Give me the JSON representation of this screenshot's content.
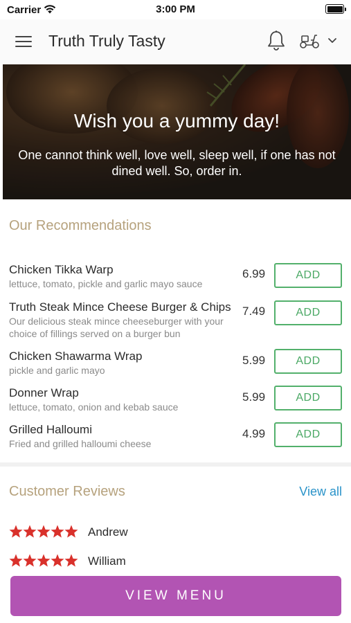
{
  "status_bar": {
    "carrier": "Carrier",
    "time": "3:00 PM"
  },
  "header": {
    "title": "Truth Truly Tasty",
    "icons": [
      "hamburger-menu-icon",
      "bell-icon",
      "scooter-icon",
      "chevron-down-icon"
    ]
  },
  "hero": {
    "title": "Wish you a yummy day!",
    "subtitle": "One cannot think well, love well, sleep well, if one has not dined well. So, order in."
  },
  "recommendations": {
    "title": "Our Recommendations",
    "items": [
      {
        "name": "Chicken Tikka Warp",
        "description": "lettuce, tomato, pickle and garlic mayo sauce",
        "price": "6.99",
        "add_label": "ADD"
      },
      {
        "name": "Truth Steak Mince Cheese Burger & Chips",
        "description": "Our delicious steak mince cheeseburger with your choice of fillings served on a burger bun",
        "price": "7.49",
        "add_label": "ADD"
      },
      {
        "name": "Chicken Shawarma Wrap",
        "description": "pickle and garlic mayo",
        "price": "5.99",
        "add_label": "ADD"
      },
      {
        "name": "Donner Wrap",
        "description": "lettuce, tomato, onion and kebab sauce",
        "price": "5.99",
        "add_label": "ADD"
      },
      {
        "name": "Grilled Halloumi",
        "description": "Fried and grilled halloumi cheese",
        "price": "4.99",
        "add_label": "ADD"
      }
    ]
  },
  "reviews": {
    "title": "Customer Reviews",
    "view_all_label": "View all",
    "items": [
      {
        "name": "Andrew",
        "rating": 5
      },
      {
        "name": "William",
        "rating": 5
      }
    ]
  },
  "cta": {
    "label": "VIEW MENU"
  },
  "colors": {
    "accent_gold": "#b6a27d",
    "add_green": "#52b06b",
    "link_blue": "#2a93c9",
    "cta_purple": "#b254b3",
    "star_red": "#d9312b"
  }
}
